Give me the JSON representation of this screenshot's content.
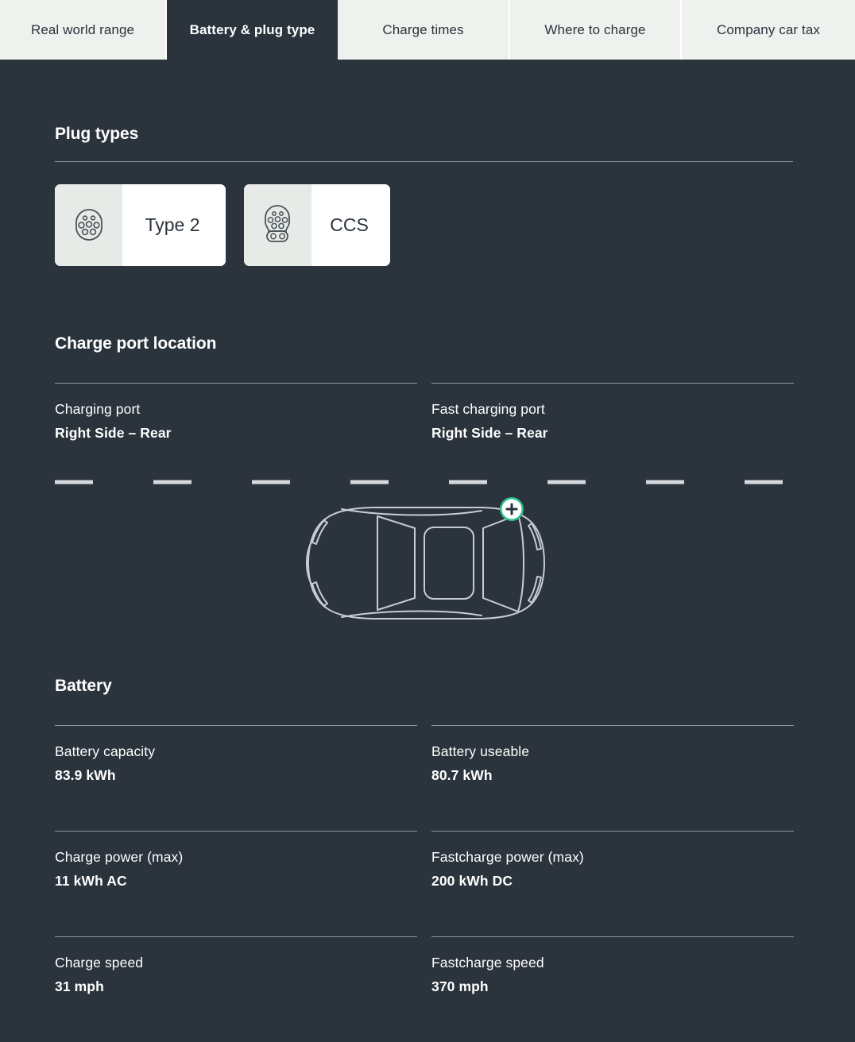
{
  "theme": {
    "background": "#2b333c",
    "tab_inactive_bg": "#eef1ee",
    "tab_active_bg": "#2b333c",
    "text_primary": "#ffffff",
    "rule_color": "#8c949c",
    "card_bg": "#ffffff",
    "card_icon_bg": "#e7ebe7",
    "marker_ring": "#2fbf8f",
    "marker_fill": "#ffffff",
    "car_stroke": "#c6ccd2"
  },
  "tabs": [
    {
      "label": "Real world range",
      "active": false
    },
    {
      "label": "Battery & plug type",
      "active": true
    },
    {
      "label": "Charge times",
      "active": false
    },
    {
      "label": "Where to charge",
      "active": false
    },
    {
      "label": "Company car tax",
      "active": false
    }
  ],
  "plug_types": {
    "heading": "Plug types",
    "cards": [
      {
        "label": "Type 2",
        "icon": "type2-plug-icon"
      },
      {
        "label": "CCS",
        "icon": "ccs-plug-icon"
      }
    ]
  },
  "charge_port_location": {
    "heading": "Charge port location",
    "fields": [
      {
        "label": "Charging port",
        "value": "Right Side – Rear"
      },
      {
        "label": "Fast charging port",
        "value": "Right Side – Rear"
      }
    ],
    "diagram": {
      "name": "car-top-view-diagram",
      "marker": {
        "name": "charge-port-marker",
        "glyph": "+",
        "position": "right-side-rear"
      }
    }
  },
  "battery": {
    "heading": "Battery",
    "rows": [
      [
        {
          "label": "Battery capacity",
          "value": "83.9 kWh"
        },
        {
          "label": "Battery useable",
          "value": "80.7 kWh"
        }
      ],
      [
        {
          "label": "Charge power (max)",
          "value": "11 kWh AC"
        },
        {
          "label": "Fastcharge power (max)",
          "value": "200 kWh DC"
        }
      ],
      [
        {
          "label": "Charge speed",
          "value": "31 mph"
        },
        {
          "label": "Fastcharge speed",
          "value": "370 mph"
        }
      ]
    ]
  }
}
